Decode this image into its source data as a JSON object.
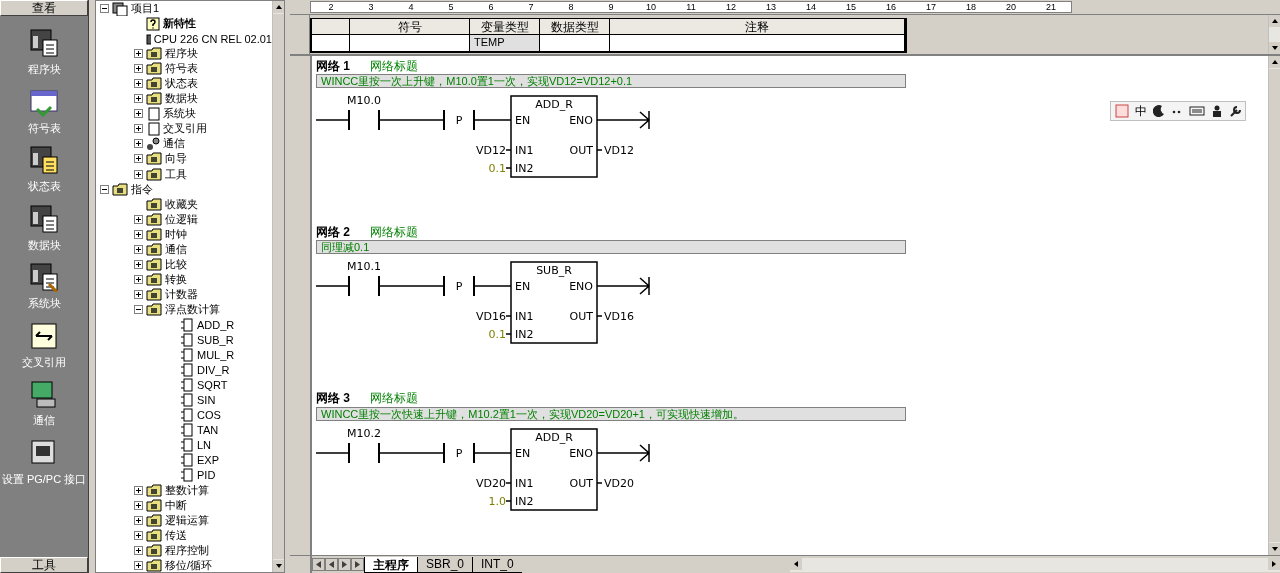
{
  "nav_bar": {
    "header": "查看",
    "footer": "工具",
    "items": [
      {
        "label": "程序块",
        "kind": "block"
      },
      {
        "label": "符号表",
        "kind": "symbol"
      },
      {
        "label": "状态表",
        "kind": "status"
      },
      {
        "label": "数据块",
        "kind": "data"
      },
      {
        "label": "系统块",
        "kind": "system"
      },
      {
        "label": "交叉引用",
        "kind": "cross"
      },
      {
        "label": "通信",
        "kind": "comm"
      },
      {
        "label": "设置 PG/PC 接口",
        "kind": "pgpc"
      }
    ]
  },
  "tree": [
    {
      "label": "项目1",
      "expanded": true,
      "kind": "project",
      "children": [
        {
          "label": "新特性",
          "kind": "help",
          "bold": true
        },
        {
          "label": "CPU 226 CN REL 02.01",
          "kind": "cpu"
        },
        {
          "label": "程序块",
          "expanded": false,
          "kind": "folder"
        },
        {
          "label": "符号表",
          "expanded": false,
          "kind": "folder"
        },
        {
          "label": "状态表",
          "expanded": false,
          "kind": "folder"
        },
        {
          "label": "数据块",
          "expanded": false,
          "kind": "folder"
        },
        {
          "label": "系统块",
          "expanded": false,
          "kind": "doc"
        },
        {
          "label": "交叉引用",
          "expanded": false,
          "kind": "doc"
        },
        {
          "label": "通信",
          "expanded": false,
          "kind": "comm"
        },
        {
          "label": "向导",
          "expanded": false,
          "kind": "folder"
        },
        {
          "label": "工具",
          "expanded": false,
          "kind": "folder"
        }
      ]
    },
    {
      "label": "指令",
      "expanded": true,
      "kind": "folder",
      "children": [
        {
          "label": "收藏夹",
          "kind": "folder"
        },
        {
          "label": "位逻辑",
          "expanded": false,
          "kind": "folder"
        },
        {
          "label": "时钟",
          "expanded": false,
          "kind": "folder"
        },
        {
          "label": "通信",
          "expanded": false,
          "kind": "folder"
        },
        {
          "label": "比较",
          "expanded": false,
          "kind": "folder"
        },
        {
          "label": "转换",
          "expanded": false,
          "kind": "folder"
        },
        {
          "label": "计数器",
          "expanded": false,
          "kind": "folder"
        },
        {
          "label": "浮点数计算",
          "expanded": true,
          "kind": "folder",
          "children": [
            {
              "label": "ADD_R",
              "kind": "box"
            },
            {
              "label": "SUB_R",
              "kind": "box"
            },
            {
              "label": "MUL_R",
              "kind": "box"
            },
            {
              "label": "DIV_R",
              "kind": "box"
            },
            {
              "label": "SQRT",
              "kind": "box"
            },
            {
              "label": "SIN",
              "kind": "box"
            },
            {
              "label": "COS",
              "kind": "box"
            },
            {
              "label": "TAN",
              "kind": "box"
            },
            {
              "label": "LN",
              "kind": "box"
            },
            {
              "label": "EXP",
              "kind": "box"
            },
            {
              "label": "PID",
              "kind": "box"
            }
          ]
        },
        {
          "label": "整数计算",
          "expanded": false,
          "kind": "folder"
        },
        {
          "label": "中断",
          "expanded": false,
          "kind": "folder"
        },
        {
          "label": "逻辑运算",
          "expanded": false,
          "kind": "folder"
        },
        {
          "label": "传送",
          "expanded": false,
          "kind": "folder"
        },
        {
          "label": "程序控制",
          "expanded": false,
          "kind": "folder"
        },
        {
          "label": "移位/循环",
          "expanded": false,
          "kind": "folder"
        }
      ]
    }
  ],
  "ruler": [
    "2",
    "3",
    "4",
    "5",
    "6",
    "7",
    "8",
    "9",
    "10",
    "11",
    "12",
    "13",
    "14",
    "15",
    "16",
    "17",
    "18",
    "20",
    "21"
  ],
  "variable_table": {
    "columns": [
      "符号",
      "变量类型",
      "数据类型",
      "注释"
    ],
    "rows": [
      {
        "variable_type": "TEMP"
      }
    ]
  },
  "networks": [
    {
      "number": "网络 1",
      "title": "网络标题",
      "comment": "WINCC里按一次上升键，M10.0置1一次，实现VD12=VD12+0.1",
      "contact": "M10.0",
      "edge": "P",
      "block": "ADD_R",
      "en": "EN",
      "eno": "ENO",
      "in1_pin": "IN1",
      "in2_pin": "IN2",
      "out_pin": "OUT",
      "in1": "VD12",
      "in2": "0.1",
      "out": "VD12"
    },
    {
      "number": "网络 2",
      "title": "网络标题",
      "comment": "同理减0.1",
      "contact": "M10.1",
      "edge": "P",
      "block": "SUB_R",
      "en": "EN",
      "eno": "ENO",
      "in1_pin": "IN1",
      "in2_pin": "IN2",
      "out_pin": "OUT",
      "in1": "VD16",
      "in2": "0.1",
      "out": "VD16"
    },
    {
      "number": "网络 3",
      "title": "网络标题",
      "comment": "WINCC里按一次快速上升键，M10.2置1一次，实现VD20=VD20+1，可实现快速增加。",
      "contact": "M10.2",
      "edge": "P",
      "block": "ADD_R",
      "en": "EN",
      "eno": "ENO",
      "in1_pin": "IN1",
      "in2_pin": "IN2",
      "out_pin": "OUT",
      "in1": "VD20",
      "in2": "1.0",
      "out": "VD20"
    }
  ],
  "ime_bar": {
    "mode": "中"
  },
  "tabs": [
    {
      "label": "主程序",
      "selected": true
    },
    {
      "label": "SBR_0",
      "selected": false
    },
    {
      "label": "INT_0",
      "selected": false
    }
  ]
}
